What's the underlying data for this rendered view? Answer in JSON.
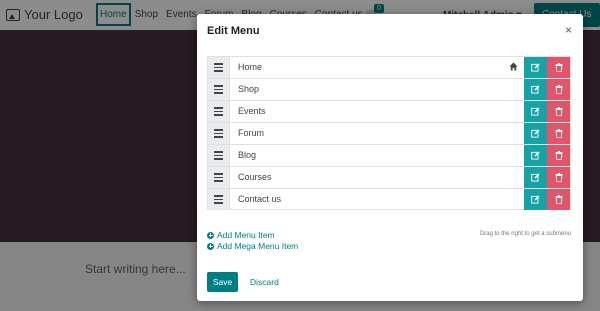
{
  "site": {
    "logo": "Your Logo",
    "nav": [
      "Home",
      "Shop",
      "Events",
      "Forum",
      "Blog",
      "Courses",
      "Contact us"
    ],
    "cart_count": "0",
    "user": "Mitchell Admin",
    "contact_button": "Contact Us",
    "writing_placeholder": "Start writing here..."
  },
  "modal": {
    "title": "Edit Menu",
    "close": "×",
    "items": [
      {
        "label": "Home",
        "is_home": true
      },
      {
        "label": "Shop"
      },
      {
        "label": "Events"
      },
      {
        "label": "Forum"
      },
      {
        "label": "Blog"
      },
      {
        "label": "Courses"
      },
      {
        "label": "Contact us"
      }
    ],
    "add_menu_item": "Add Menu Item",
    "add_mega_menu_item": "Add Mega Menu Item",
    "hint": "Drag to the right to get a submenu",
    "save": "Save",
    "discard": "Discard"
  },
  "colors": {
    "accent": "#017e84",
    "edit": "#17a2a6",
    "delete": "#e05569",
    "hero": "#4a3040"
  }
}
